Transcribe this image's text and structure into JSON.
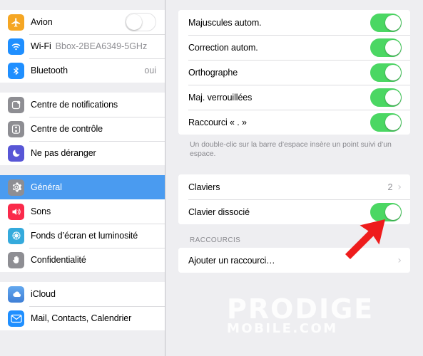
{
  "sidebar": {
    "groups": [
      {
        "items": [
          {
            "label": "Avion",
            "icon": "airplane-icon",
            "icon_color": "#f5a623",
            "control": "toggle",
            "toggle_on": false
          },
          {
            "label": "Wi-Fi",
            "icon": "wifi-icon",
            "icon_color": "#1f8fff",
            "value": "Bbox-2BEA6349-5GHz"
          },
          {
            "label": "Bluetooth",
            "icon": "bluetooth-icon",
            "icon_color": "#1f8fff",
            "right_value": "oui"
          }
        ]
      },
      {
        "items": [
          {
            "label": "Centre de notifications",
            "icon": "notification-center-icon",
            "icon_color": "#8e8e93"
          },
          {
            "label": "Centre de contrôle",
            "icon": "control-center-icon",
            "icon_color": "#8e8e93"
          },
          {
            "label": "Ne pas déranger",
            "icon": "moon-icon",
            "icon_color": "#5856d6"
          }
        ]
      },
      {
        "items": [
          {
            "label": "Général",
            "icon": "gear-icon",
            "icon_color": "#8e8e93",
            "selected": true
          },
          {
            "label": "Sons",
            "icon": "speaker-icon",
            "icon_color": "#fa2a4b"
          },
          {
            "label": "Fonds d’écran et luminosité",
            "icon": "wallpaper-icon",
            "icon_color": "#35aadc"
          },
          {
            "label": "Confidentialité",
            "icon": "hand-icon",
            "icon_color": "#8e8e93"
          }
        ]
      },
      {
        "items": [
          {
            "label": "iCloud",
            "icon": "cloud-icon",
            "icon_color": "#4a90e2"
          },
          {
            "label": "Mail, Contacts, Calendrier",
            "icon": "mail-icon",
            "icon_color": "#1f8fff"
          }
        ]
      }
    ]
  },
  "panel": {
    "keyboard_section": {
      "rows": [
        {
          "label": "Majuscules autom.",
          "control": "toggle",
          "toggle_on": true
        },
        {
          "label": "Correction autom.",
          "control": "toggle",
          "toggle_on": true
        },
        {
          "label": "Orthographe",
          "control": "toggle",
          "toggle_on": true
        },
        {
          "label": "Maj. verrouillées",
          "control": "toggle",
          "toggle_on": true
        },
        {
          "label": "Raccourci « . »",
          "control": "toggle",
          "toggle_on": true
        }
      ],
      "footnote": "Un double-clic sur la barre d’espace insère un point suivi d’un espace."
    },
    "keyboards_section": {
      "rows": [
        {
          "label": "Claviers",
          "control": "disclosure",
          "value": "2",
          "chevron": "›"
        },
        {
          "label": "Clavier dissocié",
          "control": "toggle",
          "toggle_on": true
        }
      ]
    },
    "shortcuts_section": {
      "header": "RACCOURCIS",
      "rows": [
        {
          "label": "Ajouter un raccourci…",
          "control": "disclosure",
          "chevron": "›"
        }
      ]
    }
  },
  "annotation": {
    "arrow_color": "#ee1c1c",
    "arrow_direction": "up-right"
  },
  "watermark": {
    "line1": "PRODIGE",
    "line2": "MOBILE.COM"
  },
  "colors": {
    "toggle_on": "#4bd763",
    "selection": "#4a9bf0",
    "background": "#eeeef1"
  }
}
